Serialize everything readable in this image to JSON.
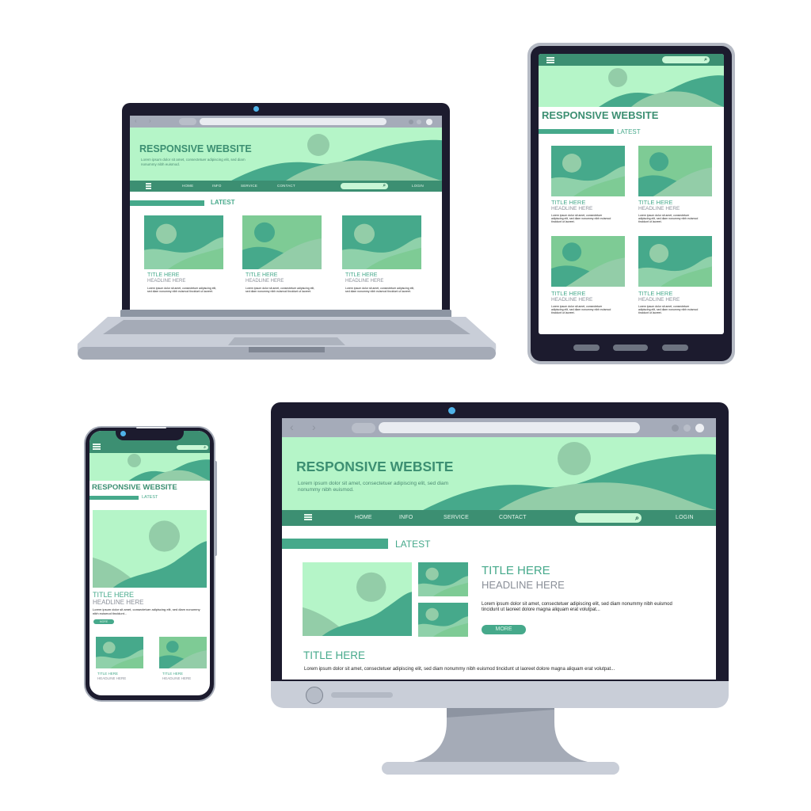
{
  "site": {
    "hero_title": "RESPONSIVE WEBSITE",
    "hero_text": "Lorem ipsum dolor sit amet, consectetuer adipiscing elit, sed diam nonummy nibh euismod.",
    "nav": {
      "menu_icon": "hamburger-icon",
      "items": [
        "HOME",
        "INFO",
        "SERVICE",
        "CONTACT"
      ],
      "search_icon": "search-icon",
      "login": "LOGIN"
    },
    "latest_label": "LATEST",
    "card_title": "TITLE HERE",
    "card_headline": "HEADLINE HERE",
    "card_body": "Lorem ipsum dolor sit amet, consectetuer adipiscing elit, sed diam nonummy nibh euismod tincidunt ut laoreet.",
    "more_label": "MORE",
    "long_body": "Lorem ipsum dolor sit amet, consectetuer adipiscing elit, sed diam nonummy nibh euismod tincidunt ut laoreet dolore magna aliquam erat volutpat...",
    "phone_body": "Lorem ipsum dolor sit amet, consectetuer adipiscing elit, sed diam nonummy nibh euismod tincidunt..."
  },
  "browser": {
    "back_icon": "chevron-left-icon",
    "forward_icon": "chevron-right-icon",
    "address_value": ""
  },
  "colors": {
    "bezel": "#1c1b2e",
    "mint": "#b5f5c8",
    "nav_green": "#3c8f72",
    "teal": "#46a98b",
    "camera": "#4fb3e8",
    "device_grey": "#a5abb7"
  },
  "devices": [
    "laptop",
    "tablet",
    "smartphone",
    "desktop-monitor"
  ]
}
